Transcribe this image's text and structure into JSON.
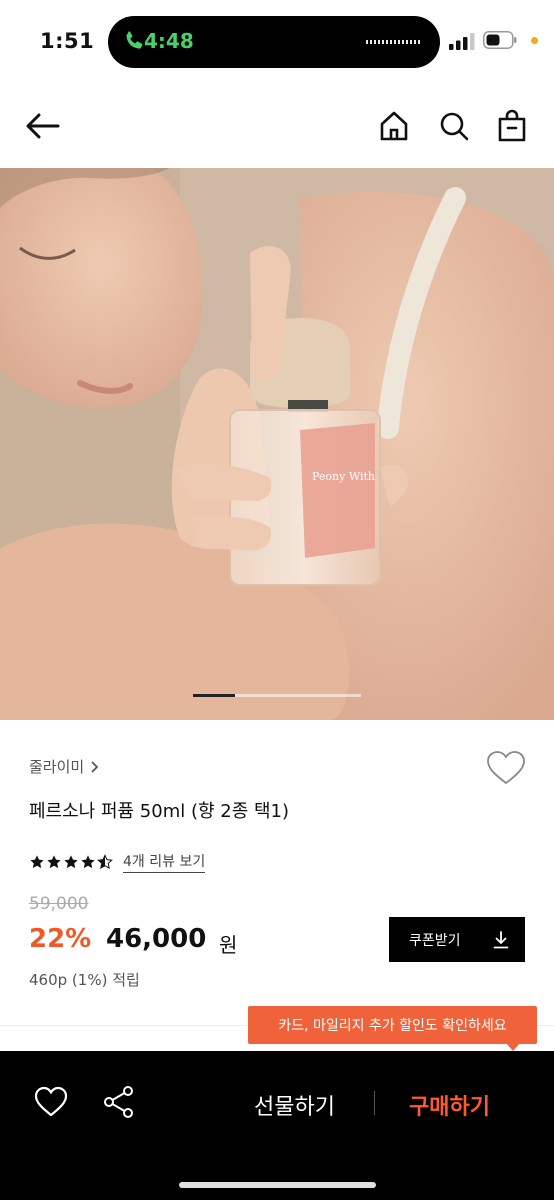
{
  "status_bar": {
    "time": "1:51",
    "call_time": "4:48",
    "call_color": "#48d16a"
  },
  "header": {
    "icons": [
      "back-arrow-icon",
      "home-icon",
      "search-icon",
      "shopping-bag-icon"
    ]
  },
  "hero": {
    "bottle_label": "Peony With",
    "carousel_progress": 0.25
  },
  "product": {
    "brand": "줄라이미",
    "title": "페르소나 퍼퓸 50ml (향 2종 택1)",
    "rating": 4.5,
    "review_link": "4개 리뷰 보기",
    "original_price": "59,000",
    "discount": "22%",
    "sale_price": "46,000",
    "currency": "원",
    "coupon_button": "쿠폰받기",
    "points": "460p (1%) 적립",
    "tooltip": "카드, 마일리지 추가 할인도 확인하세요"
  },
  "bottom_bar": {
    "gift_label": "선물하기",
    "buy_label": "구매하기",
    "accent_color": "#ff5a2c"
  },
  "colors": {
    "discount": "#f05a24",
    "tooltip_bg": "#f0633a"
  }
}
